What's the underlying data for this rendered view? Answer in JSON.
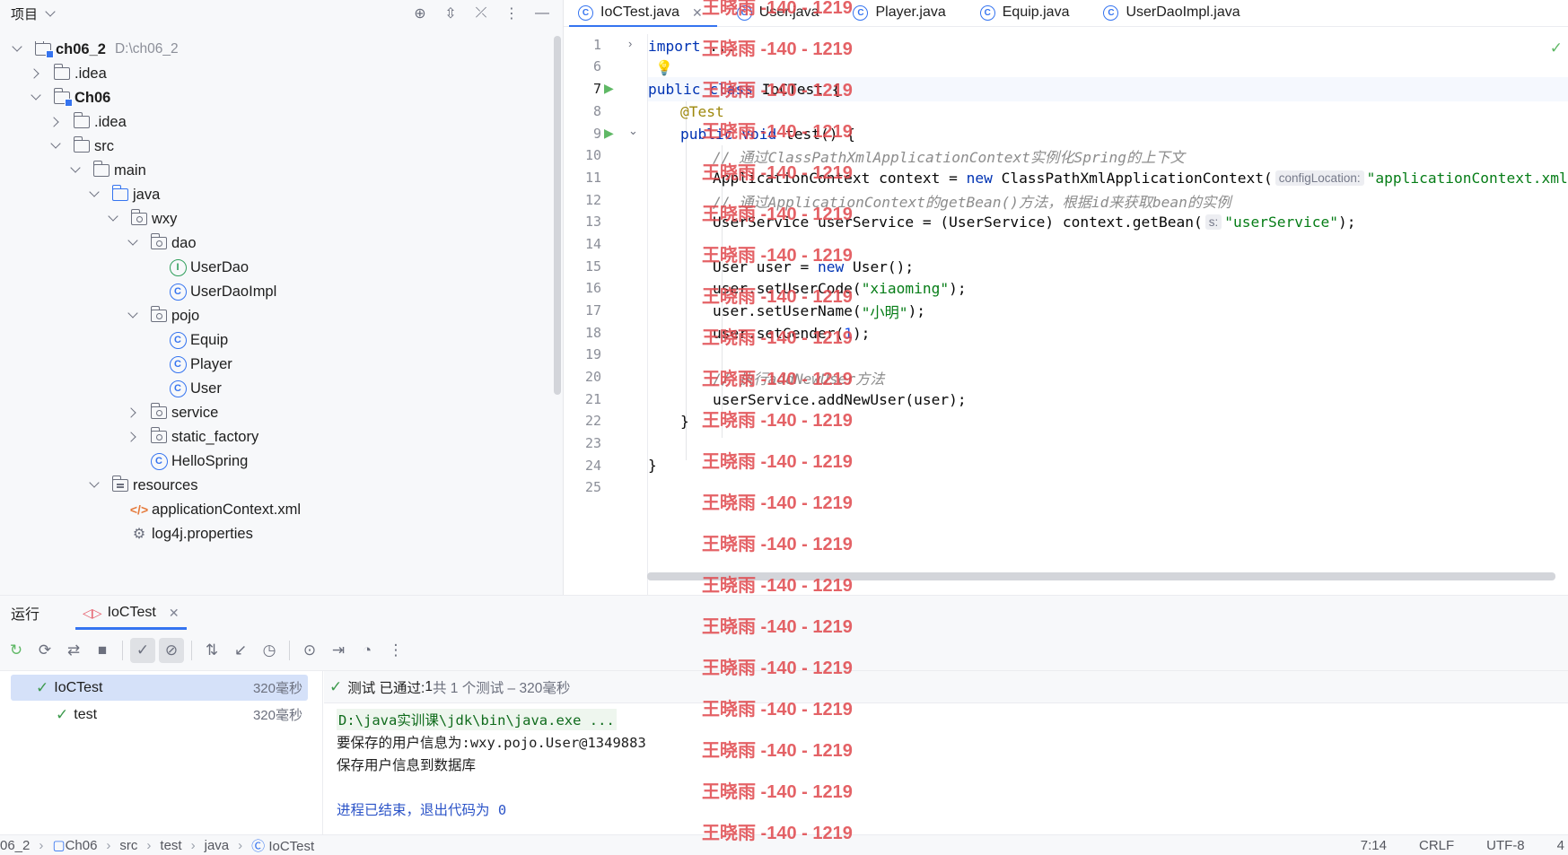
{
  "project_panel": {
    "title": "项目",
    "tree": [
      {
        "label": "ch06_2",
        "hint": "D:\\ch06_2",
        "bold": true
      },
      {
        "label": ".idea"
      },
      {
        "label": "Ch06",
        "bold": true
      },
      {
        "label": ".idea"
      },
      {
        "label": "src"
      },
      {
        "label": "main"
      },
      {
        "label": "java"
      },
      {
        "label": "wxy"
      },
      {
        "label": "dao"
      },
      {
        "label": "UserDao"
      },
      {
        "label": "UserDaoImpl"
      },
      {
        "label": "pojo"
      },
      {
        "label": "Equip"
      },
      {
        "label": "Player"
      },
      {
        "label": "User"
      },
      {
        "label": "service"
      },
      {
        "label": "static_factory"
      },
      {
        "label": "HelloSpring"
      },
      {
        "label": "resources"
      },
      {
        "label": "applicationContext.xml"
      },
      {
        "label": "log4j.properties"
      }
    ]
  },
  "editor": {
    "tabs": [
      {
        "label": "IoCTest.java",
        "active": true
      },
      {
        "label": "User.java"
      },
      {
        "label": "Player.java"
      },
      {
        "label": "Equip.java"
      },
      {
        "label": "UserDaoImpl.java"
      }
    ],
    "line_numbers": [
      "1",
      "6",
      "7",
      "8",
      "9",
      "10",
      "11",
      "12",
      "13",
      "14",
      "15",
      "16",
      "17",
      "18",
      "19",
      "20",
      "21",
      "22",
      "23",
      "24",
      "25"
    ],
    "code": {
      "l1_import": "import",
      "l1_dots": " ...",
      "l7_public": "public",
      "l7_class": " class",
      "l7_rest": " IoCTest {",
      "l8_ann": "@Test",
      "l9_public": "public",
      "l9_void": " void",
      "l9_rest": " test() {",
      "l10_cmt": "// 通过ClassPathXmlApplicationContext实例化Spring的上下文",
      "l11_a": "ApplicationContext context = ",
      "l11_new": "new",
      "l11_b": " ClassPathXmlApplicationContext(",
      "l11_hint": "configLocation:",
      "l11_str": "\"applicationContext.xml\"",
      "l12_cmt": "// 通过ApplicationContext的getBean()方法，根据id来获取bean的实例",
      "l13_a": "UserService userService = (UserService) context.getBean(",
      "l13_hint": "s:",
      "l13_str": "\"userService\"",
      "l13_b": ");",
      "l15_a": "User user = ",
      "l15_new": "new",
      "l15_b": " User();",
      "l16_a": "user.setUserCode(",
      "l16_str": "\"xiaoming\"",
      "l16_b": ");",
      "l17_a": "user.setUserName(",
      "l17_str": "\"小明\"",
      "l17_b": ");",
      "l18_a": "user.setGender(",
      "l18_num": "1",
      "l18_b": ");",
      "l20_cmt": "// 执行addNewUser方法",
      "l21": "userService.addNewUser(user);",
      "l22": "}",
      "l24": "}"
    }
  },
  "run_panel": {
    "title": "运行",
    "tab_label": "IoCTest",
    "tree": [
      {
        "label": "IoCTest",
        "time": "320毫秒"
      },
      {
        "label": "test",
        "time": "320毫秒"
      }
    ],
    "status_prefix": "测试 已通过:",
    "status_count": " 1",
    "status_suffix": "共 1 个测试 – 320毫秒",
    "console": {
      "cmd": "D:\\java实训课\\jdk\\bin\\java.exe ...",
      "line1": "要保存的用户信息为:wxy.pojo.User@1349883",
      "line2": "保存用户信息到数据库",
      "exit": "进程已结束，退出代码为 0"
    }
  },
  "statusbar": {
    "crumbs": [
      "06_2",
      "Ch06",
      "src",
      "test",
      "java",
      "IoCTest"
    ],
    "position": "7:14",
    "line_sep": "CRLF",
    "encoding": "UTF-8",
    "extra": "4"
  },
  "watermark": "王晓雨 -140 - 1219"
}
